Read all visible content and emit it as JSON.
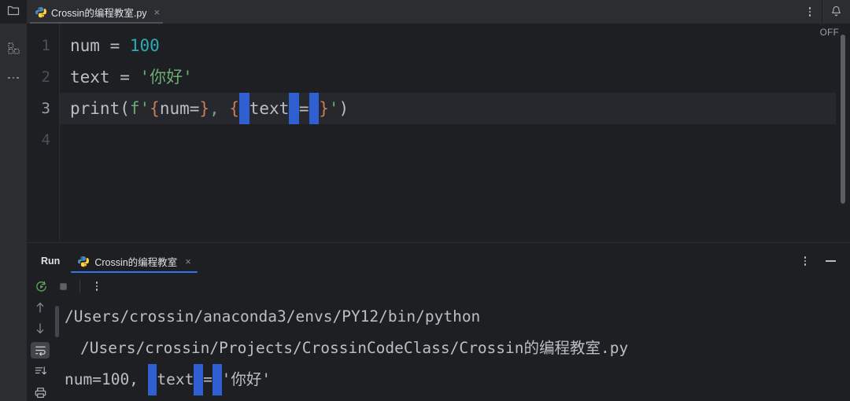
{
  "window": {
    "theme_bg": "#1e1f22",
    "accent": "#3574f0",
    "selection_blue": "#2f5fd1"
  },
  "topbar": {
    "folder_icon": "folder-icon",
    "menu_icon": "more-vertical-icon",
    "notification_icon": "bell-icon",
    "tabs": [
      {
        "label": "Crossin的编程教室.py",
        "icon": "python-file-icon",
        "close": "×",
        "active": true
      }
    ]
  },
  "left_rail": {
    "items": [
      {
        "icon": "structure-icon",
        "name": "structure"
      },
      {
        "icon": "more-horizontal-icon",
        "name": "more-tool-windows"
      }
    ]
  },
  "editor": {
    "inspection_status": "OFF",
    "line_numbers": [
      "1",
      "2",
      "3",
      "4"
    ],
    "current_line": 3,
    "lines": [
      {
        "number": "1",
        "tokens": [
          {
            "t": "num ",
            "c": "plain"
          },
          {
            "t": "= ",
            "c": "plain"
          },
          {
            "t": "100",
            "c": "number"
          }
        ]
      },
      {
        "number": "2",
        "tokens": [
          {
            "t": "text ",
            "c": "plain"
          },
          {
            "t": "= ",
            "c": "plain"
          },
          {
            "t": "'你好'",
            "c": "string"
          }
        ]
      },
      {
        "number": "3",
        "tokens": [
          {
            "t": "print(",
            "c": "plain"
          },
          {
            "t": "f",
            "c": "fprefix"
          },
          {
            "t": "'",
            "c": "string"
          },
          {
            "t": "{",
            "c": "brace"
          },
          {
            "t": "num=",
            "c": "plain"
          },
          {
            "t": "}",
            "c": "brace"
          },
          {
            "t": ",",
            "c": "string"
          },
          {
            "t": " ",
            "c": "plain"
          },
          {
            "t": "{",
            "c": "brace"
          },
          {
            "t": " ",
            "c": "ws-highlight"
          },
          {
            "t": "text",
            "c": "plain"
          },
          {
            "t": " ",
            "c": "ws-highlight"
          },
          {
            "t": "=",
            "c": "plain"
          },
          {
            "t": " ",
            "c": "ws-highlight"
          },
          {
            "t": "}",
            "c": "brace"
          },
          {
            "t": "'",
            "c": "string"
          },
          {
            "t": ")",
            "c": "plain"
          }
        ]
      },
      {
        "number": "4",
        "tokens": []
      }
    ],
    "scrollbar": "vertical-scrollbar"
  },
  "run_panel": {
    "title": "Run",
    "tabs": [
      {
        "label": "Crossin的编程教室",
        "icon": "python-file-icon",
        "close": "×",
        "active": true
      }
    ],
    "header_buttons": [
      {
        "icon": "more-vertical-icon",
        "name": "run-options"
      },
      {
        "icon": "minimize-icon",
        "name": "minimize-panel"
      }
    ],
    "toolbar": [
      {
        "icon": "rerun-icon",
        "name": "rerun"
      },
      {
        "icon": "stop-icon",
        "name": "stop"
      },
      {
        "icon": "more-vertical-icon",
        "name": "run-more"
      }
    ],
    "gutter_buttons": [
      {
        "icon": "arrow-up-icon",
        "name": "previous-occurrence",
        "selected": false
      },
      {
        "icon": "arrow-down-icon",
        "name": "next-occurrence",
        "selected": false
      },
      {
        "icon": "soft-wrap-icon",
        "name": "soft-wrap",
        "selected": true
      },
      {
        "icon": "scroll-to-end-icon",
        "name": "scroll-to-end",
        "selected": false
      },
      {
        "icon": "print-icon",
        "name": "print",
        "selected": false
      }
    ],
    "console": {
      "lines": [
        {
          "indent": false,
          "tokens": [
            {
              "t": "/Users/crossin/anaconda3/envs/PY12/bin/python",
              "c": "plain"
            }
          ]
        },
        {
          "indent": true,
          "tokens": [
            {
              "t": "/Users/crossin/Projects/CrossinCodeClass/Crossin的编程教室.py",
              "c": "plain"
            }
          ]
        },
        {
          "indent": false,
          "tokens": [
            {
              "t": "num=100, ",
              "c": "plain"
            },
            {
              "t": " ",
              "c": "ws-highlight"
            },
            {
              "t": "text",
              "c": "plain"
            },
            {
              "t": " ",
              "c": "ws-highlight"
            },
            {
              "t": "=",
              "c": "plain"
            },
            {
              "t": " ",
              "c": "ws-highlight"
            },
            {
              "t": "'你好'",
              "c": "plain"
            }
          ]
        }
      ]
    }
  }
}
